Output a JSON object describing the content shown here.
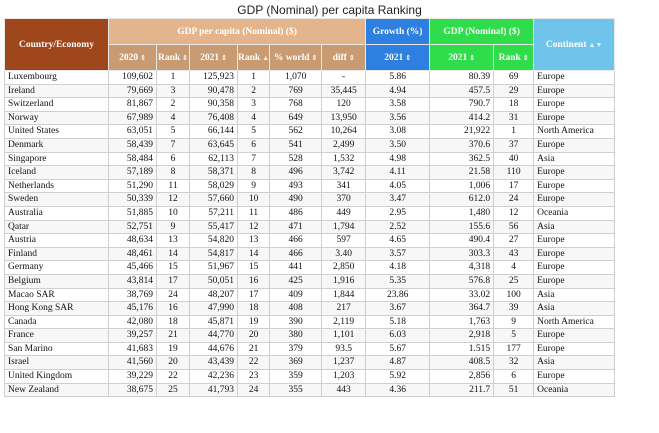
{
  "title": "GDP (Nominal) per capita Ranking",
  "header": {
    "country": "Country/Economy",
    "gdp_pc": "GDP per capita (Nominal) ($)",
    "growth": "Growth (%)",
    "gdp_nominal": "GDP (Nominal) ($)",
    "continent": "Continent",
    "sub": {
      "y2020": "2020",
      "rank1": "Rank",
      "y2021": "2021",
      "rank2": "Rank",
      "world": "% world",
      "diff": "diff",
      "growth2021": "2021",
      "nom2021": "2021",
      "nomrank": "Rank"
    }
  },
  "rows": [
    [
      "Luxembourg",
      "109,602",
      "1",
      "125,923",
      "1",
      "1,070",
      "-",
      "5.86",
      "80.39",
      "69",
      "Europe"
    ],
    [
      "Ireland",
      "79,669",
      "3",
      "90,478",
      "2",
      "769",
      "35,445",
      "4.94",
      "457.5",
      "29",
      "Europe"
    ],
    [
      "Switzerland",
      "81,867",
      "2",
      "90,358",
      "3",
      "768",
      "120",
      "3.58",
      "790.7",
      "18",
      "Europe"
    ],
    [
      "Norway",
      "67,989",
      "4",
      "76,408",
      "4",
      "649",
      "13,950",
      "3.56",
      "414.2",
      "31",
      "Europe"
    ],
    [
      "United States",
      "63,051",
      "5",
      "66,144",
      "5",
      "562",
      "10,264",
      "3.08",
      "21,922",
      "1",
      "North America"
    ],
    [
      "Denmark",
      "58,439",
      "7",
      "63,645",
      "6",
      "541",
      "2,499",
      "3.50",
      "370.6",
      "37",
      "Europe"
    ],
    [
      "Singapore",
      "58,484",
      "6",
      "62,113",
      "7",
      "528",
      "1,532",
      "4.98",
      "362.5",
      "40",
      "Asia"
    ],
    [
      "Iceland",
      "57,189",
      "8",
      "58,371",
      "8",
      "496",
      "3,742",
      "4.11",
      "21.58",
      "110",
      "Europe"
    ],
    [
      "Netherlands",
      "51,290",
      "11",
      "58,029",
      "9",
      "493",
      "341",
      "4.05",
      "1,006",
      "17",
      "Europe"
    ],
    [
      "Sweden",
      "50,339",
      "12",
      "57,660",
      "10",
      "490",
      "370",
      "3.47",
      "612.0",
      "24",
      "Europe"
    ],
    [
      "Australia",
      "51,885",
      "10",
      "57,211",
      "11",
      "486",
      "449",
      "2.95",
      "1,480",
      "12",
      "Oceania"
    ],
    [
      "Qatar",
      "52,751",
      "9",
      "55,417",
      "12",
      "471",
      "1,794",
      "2.52",
      "155.6",
      "56",
      "Asia"
    ],
    [
      "Austria",
      "48,634",
      "13",
      "54,820",
      "13",
      "466",
      "597",
      "4.65",
      "490.4",
      "27",
      "Europe"
    ],
    [
      "Finland",
      "48,461",
      "14",
      "54,817",
      "14",
      "466",
      "3.40",
      "3.57",
      "303.3",
      "43",
      "Europe"
    ],
    [
      "Germany",
      "45,466",
      "15",
      "51,967",
      "15",
      "441",
      "2,850",
      "4.18",
      "4,318",
      "4",
      "Europe"
    ],
    [
      "Belgium",
      "43,814",
      "17",
      "50,051",
      "16",
      "425",
      "1,916",
      "5.35",
      "576.8",
      "25",
      "Europe"
    ],
    [
      "Macao SAR",
      "38,769",
      "24",
      "48,207",
      "17",
      "409",
      "1,844",
      "23.86",
      "33.02",
      "100",
      "Asia"
    ],
    [
      "Hong Kong SAR",
      "45,176",
      "16",
      "47,990",
      "18",
      "408",
      "217",
      "3.67",
      "364.7",
      "39",
      "Asia"
    ],
    [
      "Canada",
      "42,080",
      "18",
      "45,871",
      "19",
      "390",
      "2,119",
      "5.18",
      "1,763",
      "9",
      "North America"
    ],
    [
      "France",
      "39,257",
      "21",
      "44,770",
      "20",
      "380",
      "1,101",
      "6.03",
      "2,918",
      "5",
      "Europe"
    ],
    [
      "San Marino",
      "41,683",
      "19",
      "44,676",
      "21",
      "379",
      "93.5",
      "5.67",
      "1.515",
      "177",
      "Europe"
    ],
    [
      "Israel",
      "41,560",
      "20",
      "43,439",
      "22",
      "369",
      "1,237",
      "4.87",
      "408.5",
      "32",
      "Asia"
    ],
    [
      "United Kingdom",
      "39,229",
      "22",
      "42,236",
      "23",
      "359",
      "1,203",
      "5.92",
      "2,856",
      "6",
      "Europe"
    ],
    [
      "New Zealand",
      "38,675",
      "25",
      "41,793",
      "24",
      "355",
      "443",
      "4.36",
      "211.7",
      "51",
      "Oceania"
    ]
  ]
}
